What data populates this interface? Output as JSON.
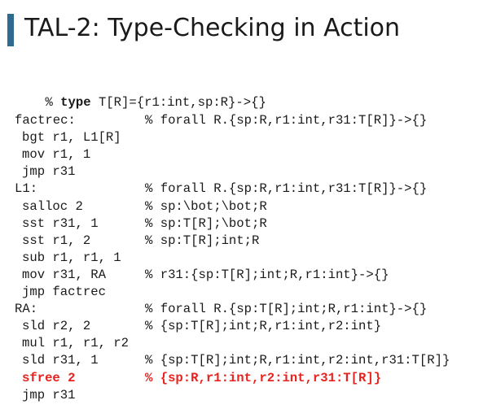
{
  "slide": {
    "title": "TAL-2: Type-Checking in Action"
  },
  "typedef": {
    "prefix": "% ",
    "keyword": "type",
    "rest": " T[R]={r1:int,sp:R}->{}"
  },
  "lines": [
    {
      "code": "factrec:",
      "indent": false,
      "comment": "% forall R.{sp:R,r1:int,r31:T[R]}->{}"
    },
    {
      "code": "bgt r1, L1[R]",
      "indent": true,
      "comment": ""
    },
    {
      "code": "mov r1, 1",
      "indent": true,
      "comment": ""
    },
    {
      "code": "jmp r31",
      "indent": true,
      "comment": ""
    },
    {
      "code": "L1:",
      "indent": false,
      "comment": "% forall R.{sp:R,r1:int,r31:T[R]}->{}"
    },
    {
      "code": "salloc 2",
      "indent": true,
      "comment": "% sp:\\bot;\\bot;R"
    },
    {
      "code": "sst r31, 1",
      "indent": true,
      "comment": "% sp:T[R];\\bot;R"
    },
    {
      "code": "sst r1, 2",
      "indent": true,
      "comment": "% sp:T[R];int;R"
    },
    {
      "code": "sub r1, r1, 1",
      "indent": true,
      "comment": ""
    },
    {
      "code": "mov r31, RA",
      "indent": true,
      "comment": "% r31:{sp:T[R];int;R,r1:int}->{}"
    },
    {
      "code": "jmp factrec",
      "indent": true,
      "comment": ""
    },
    {
      "code": "RA:",
      "indent": false,
      "comment": "% forall R.{sp:T[R];int;R,r1:int}->{}"
    },
    {
      "code": "sld r2, 2",
      "indent": true,
      "comment": "% {sp:T[R];int;R,r1:int,r2:int}"
    },
    {
      "code": "mul r1, r1, r2",
      "indent": true,
      "comment": ""
    },
    {
      "code": "sld r31, 1",
      "indent": true,
      "comment": "% {sp:T[R];int;R,r1:int,r2:int,r31:T[R]}"
    },
    {
      "code": "sfree 2",
      "indent": true,
      "comment": "% {sp:R,r1:int,r2:int,r31:T[R]}",
      "highlight": true
    },
    {
      "code": "jmp r31",
      "indent": true,
      "comment": ""
    }
  ],
  "colors": {
    "accent_bar": "#2e6b8f",
    "highlight": "#e8231f",
    "text": "#1a1a1a"
  }
}
